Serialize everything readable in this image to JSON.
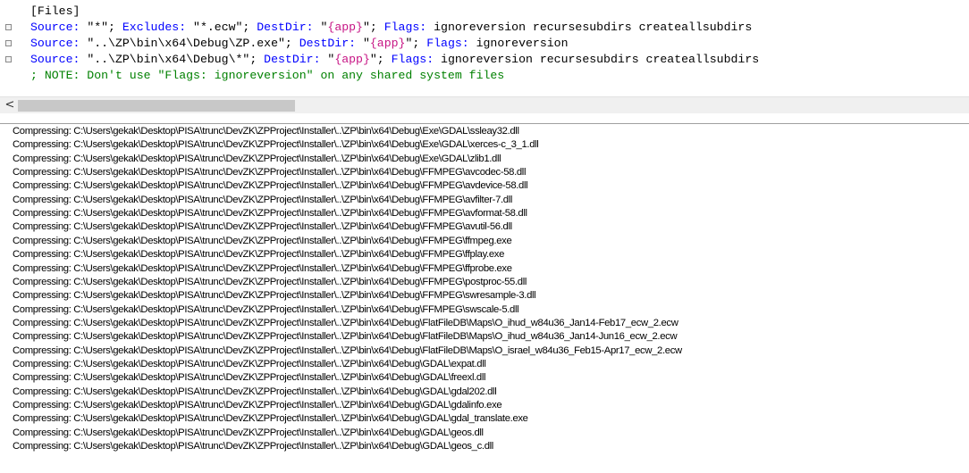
{
  "editor": {
    "lines": [
      {
        "marker": false,
        "tokens": [
          {
            "t": "[Files]",
            "c": "plain"
          }
        ]
      },
      {
        "marker": true,
        "tokens": [
          {
            "t": "Source:",
            "c": "kw"
          },
          {
            "t": " \"*\"; ",
            "c": "str"
          },
          {
            "t": "Excludes:",
            "c": "kw"
          },
          {
            "t": " \"*.ecw\"; ",
            "c": "str"
          },
          {
            "t": "DestDir:",
            "c": "kw"
          },
          {
            "t": " \"",
            "c": "str"
          },
          {
            "t": "{app}",
            "c": "const"
          },
          {
            "t": "\"; ",
            "c": "str"
          },
          {
            "t": "Flags:",
            "c": "kw"
          },
          {
            "t": " ignoreversion recursesubdirs createallsubdirs",
            "c": "str"
          }
        ]
      },
      {
        "marker": true,
        "tokens": [
          {
            "t": "Source:",
            "c": "kw"
          },
          {
            "t": " \"..\\ZP\\bin\\x64\\Debug\\ZP.exe\"; ",
            "c": "str"
          },
          {
            "t": "DestDir:",
            "c": "kw"
          },
          {
            "t": " \"",
            "c": "str"
          },
          {
            "t": "{app}",
            "c": "const"
          },
          {
            "t": "\"; ",
            "c": "str"
          },
          {
            "t": "Flags:",
            "c": "kw"
          },
          {
            "t": " ignoreversion",
            "c": "str"
          }
        ]
      },
      {
        "marker": true,
        "tokens": [
          {
            "t": "Source:",
            "c": "kw"
          },
          {
            "t": " \"..\\ZP\\bin\\x64\\Debug\\*\"; ",
            "c": "str"
          },
          {
            "t": "DestDir:",
            "c": "kw"
          },
          {
            "t": " \"",
            "c": "str"
          },
          {
            "t": "{app}",
            "c": "const"
          },
          {
            "t": "\"; ",
            "c": "str"
          },
          {
            "t": "Flags:",
            "c": "kw"
          },
          {
            "t": " ignoreversion recursesubdirs createallsubdirs",
            "c": "str"
          }
        ]
      },
      {
        "marker": false,
        "tokens": [
          {
            "t": "; NOTE: Don't use \"Flags: ignoreversion\" on any shared system files",
            "c": "cmt"
          }
        ]
      }
    ]
  },
  "scrollbar": {
    "left_arrow": "<"
  },
  "output": {
    "prefix": "Compressing: C:\\Users\\gekak\\Desktop\\PISA\\trunc\\DevZK\\ZPProject\\Installer\\..\\ZP\\bin\\x64\\Debug\\",
    "lines": [
      "Compressing: C:\\Users\\gekak\\Desktop\\PISA\\trunc\\DevZK\\ZPProject\\Installer\\..\\ZP\\bin\\x64\\Debug\\Exe\\GDAL\\ssleay32.dll",
      "Compressing: C:\\Users\\gekak\\Desktop\\PISA\\trunc\\DevZK\\ZPProject\\Installer\\..\\ZP\\bin\\x64\\Debug\\Exe\\GDAL\\xerces-c_3_1.dll",
      "Compressing: C:\\Users\\gekak\\Desktop\\PISA\\trunc\\DevZK\\ZPProject\\Installer\\..\\ZP\\bin\\x64\\Debug\\Exe\\GDAL\\zlib1.dll",
      "Compressing: C:\\Users\\gekak\\Desktop\\PISA\\trunc\\DevZK\\ZPProject\\Installer\\..\\ZP\\bin\\x64\\Debug\\FFMPEG\\avcodec-58.dll",
      "Compressing: C:\\Users\\gekak\\Desktop\\PISA\\trunc\\DevZK\\ZPProject\\Installer\\..\\ZP\\bin\\x64\\Debug\\FFMPEG\\avdevice-58.dll",
      "Compressing: C:\\Users\\gekak\\Desktop\\PISA\\trunc\\DevZK\\ZPProject\\Installer\\..\\ZP\\bin\\x64\\Debug\\FFMPEG\\avfilter-7.dll",
      "Compressing: C:\\Users\\gekak\\Desktop\\PISA\\trunc\\DevZK\\ZPProject\\Installer\\..\\ZP\\bin\\x64\\Debug\\FFMPEG\\avformat-58.dll",
      "Compressing: C:\\Users\\gekak\\Desktop\\PISA\\trunc\\DevZK\\ZPProject\\Installer\\..\\ZP\\bin\\x64\\Debug\\FFMPEG\\avutil-56.dll",
      "Compressing: C:\\Users\\gekak\\Desktop\\PISA\\trunc\\DevZK\\ZPProject\\Installer\\..\\ZP\\bin\\x64\\Debug\\FFMPEG\\ffmpeg.exe",
      "Compressing: C:\\Users\\gekak\\Desktop\\PISA\\trunc\\DevZK\\ZPProject\\Installer\\..\\ZP\\bin\\x64\\Debug\\FFMPEG\\ffplay.exe",
      "Compressing: C:\\Users\\gekak\\Desktop\\PISA\\trunc\\DevZK\\ZPProject\\Installer\\..\\ZP\\bin\\x64\\Debug\\FFMPEG\\ffprobe.exe",
      "Compressing: C:\\Users\\gekak\\Desktop\\PISA\\trunc\\DevZK\\ZPProject\\Installer\\..\\ZP\\bin\\x64\\Debug\\FFMPEG\\postproc-55.dll",
      "Compressing: C:\\Users\\gekak\\Desktop\\PISA\\trunc\\DevZK\\ZPProject\\Installer\\..\\ZP\\bin\\x64\\Debug\\FFMPEG\\swresample-3.dll",
      "Compressing: C:\\Users\\gekak\\Desktop\\PISA\\trunc\\DevZK\\ZPProject\\Installer\\..\\ZP\\bin\\x64\\Debug\\FFMPEG\\swscale-5.dll",
      "Compressing: C:\\Users\\gekak\\Desktop\\PISA\\trunc\\DevZK\\ZPProject\\Installer\\..\\ZP\\bin\\x64\\Debug\\FlatFileDB\\Maps\\O_ihud_w84u36_Jan14-Feb17_ecw_2.ecw",
      "Compressing: C:\\Users\\gekak\\Desktop\\PISA\\trunc\\DevZK\\ZPProject\\Installer\\..\\ZP\\bin\\x64\\Debug\\FlatFileDB\\Maps\\O_ihud_w84u36_Jan14-Jun16_ecw_2.ecw",
      "Compressing: C:\\Users\\gekak\\Desktop\\PISA\\trunc\\DevZK\\ZPProject\\Installer\\..\\ZP\\bin\\x64\\Debug\\FlatFileDB\\Maps\\O_israel_w84u36_Feb15-Apr17_ecw_2.ecw",
      "Compressing: C:\\Users\\gekak\\Desktop\\PISA\\trunc\\DevZK\\ZPProject\\Installer\\..\\ZP\\bin\\x64\\Debug\\GDAL\\expat.dll",
      "Compressing: C:\\Users\\gekak\\Desktop\\PISA\\trunc\\DevZK\\ZPProject\\Installer\\..\\ZP\\bin\\x64\\Debug\\GDAL\\freexl.dll",
      "Compressing: C:\\Users\\gekak\\Desktop\\PISA\\trunc\\DevZK\\ZPProject\\Installer\\..\\ZP\\bin\\x64\\Debug\\GDAL\\gdal202.dll",
      "Compressing: C:\\Users\\gekak\\Desktop\\PISA\\trunc\\DevZK\\ZPProject\\Installer\\..\\ZP\\bin\\x64\\Debug\\GDAL\\gdalinfo.exe",
      "Compressing: C:\\Users\\gekak\\Desktop\\PISA\\trunc\\DevZK\\ZPProject\\Installer\\..\\ZP\\bin\\x64\\Debug\\GDAL\\gdal_translate.exe",
      "Compressing: C:\\Users\\gekak\\Desktop\\PISA\\trunc\\DevZK\\ZPProject\\Installer\\..\\ZP\\bin\\x64\\Debug\\GDAL\\geos.dll",
      "Compressing: C:\\Users\\gekak\\Desktop\\PISA\\trunc\\DevZK\\ZPProject\\Installer\\..\\ZP\\bin\\x64\\Debug\\GDAL\\geos_c.dll"
    ]
  },
  "colors": {
    "keyword": "#0000ff",
    "constant": "#c71585",
    "comment": "#008000",
    "text": "#000000"
  }
}
